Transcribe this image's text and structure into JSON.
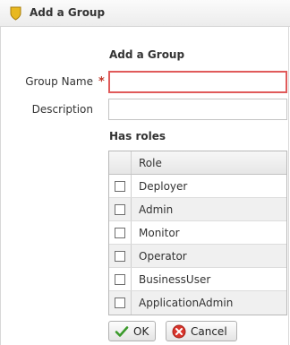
{
  "window": {
    "title": "Add a Group",
    "icon": "shield-icon"
  },
  "form": {
    "section_heading": "Add a Group",
    "group_name_label": "Group Name",
    "required_marker": "*",
    "group_name_value": "",
    "description_label": "Description",
    "description_value": ""
  },
  "roles": {
    "heading": "Has roles",
    "column_header": "Role",
    "items": [
      {
        "label": "Deployer",
        "checked": false
      },
      {
        "label": "Admin",
        "checked": false
      },
      {
        "label": "Monitor",
        "checked": false
      },
      {
        "label": "Operator",
        "checked": false
      },
      {
        "label": "BusinessUser",
        "checked": false
      },
      {
        "label": "ApplicationAdmin",
        "checked": false
      }
    ]
  },
  "buttons": {
    "ok": "OK",
    "cancel": "Cancel"
  },
  "colors": {
    "required": "#c0392b",
    "invalid_border": "#e05a5a",
    "ok_check": "#3a9a2a",
    "cancel_icon": "#d9342b"
  }
}
